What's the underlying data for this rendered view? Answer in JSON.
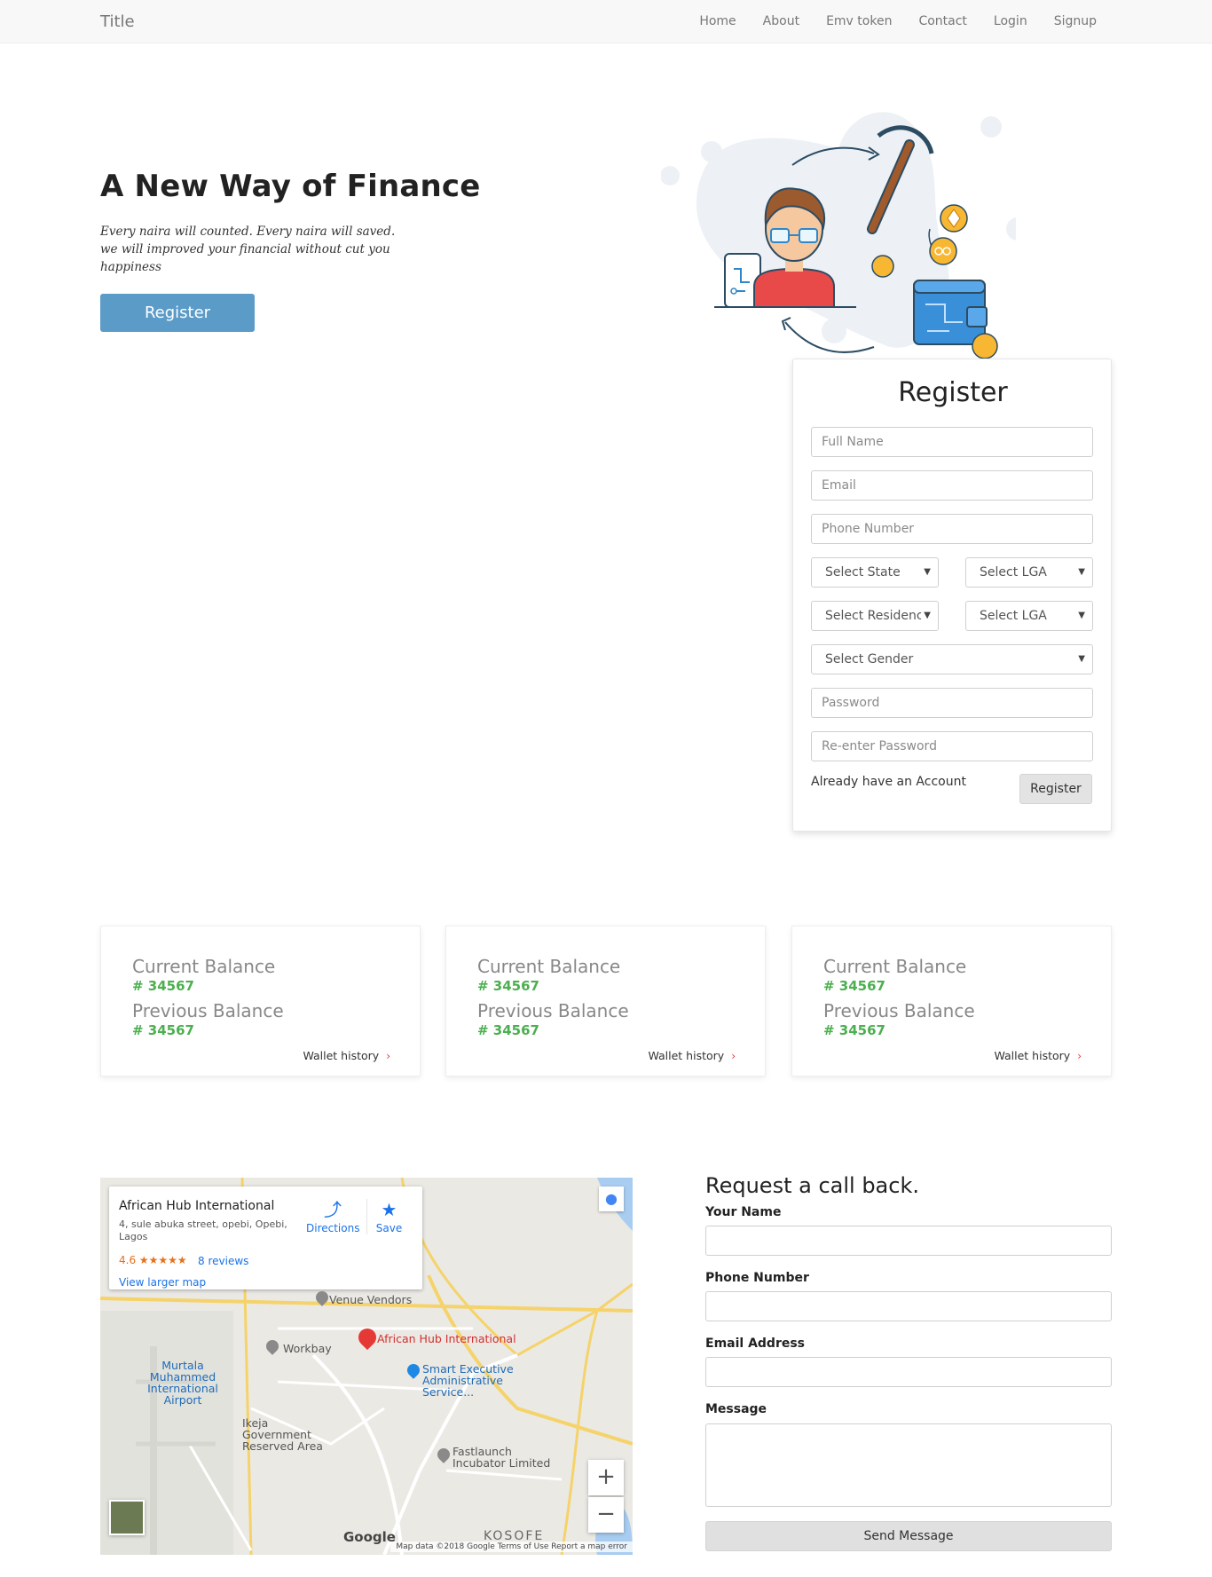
{
  "navbar": {
    "brand": "Title",
    "links": [
      "Home",
      "About",
      "Emv token",
      "Contact",
      "Login",
      "Signup"
    ]
  },
  "hero": {
    "title": "A New Way of Finance",
    "subtitle_line1": "Every naira will counted. Every naira will saved.",
    "subtitle_line2": "we will improved your financial without cut you happiness",
    "button": "Register"
  },
  "register_form": {
    "title": "Register",
    "full_name_placeholder": "Full Name",
    "email_placeholder": "Email",
    "phone_placeholder": "Phone Number",
    "select_state": "Select State",
    "select_lga": "Select LGA",
    "select_residence": "Select Residence",
    "select_lga_2": "Select LGA",
    "select_gender": "Select Gender",
    "password_placeholder": "Password",
    "reenter_password_placeholder": "Re-enter Password",
    "already_account": "Already have an Account",
    "submit": "Register"
  },
  "balances": [
    {
      "current_label": "Current Balance",
      "current_value": "# 34567",
      "previous_label": "Previous Balance",
      "previous_value": "# 34567",
      "link": "Wallet history"
    },
    {
      "current_label": "Current Balance",
      "current_value": "# 34567",
      "previous_label": "Previous Balance",
      "previous_value": "# 34567",
      "link": "Wallet history"
    },
    {
      "current_label": "Current Balance",
      "current_value": "# 34567",
      "previous_label": "Previous Balance",
      "previous_value": "# 34567",
      "link": "Wallet history"
    }
  ],
  "map": {
    "place_name": "African Hub International",
    "address": "4, sule abuka street, opebi, Opebi, Lagos",
    "rating": "4.6 ★★★★★",
    "reviews": "8 reviews",
    "view_larger": "View larger map",
    "directions": "Directions",
    "save": "Save",
    "labels": {
      "venue_vendors": "Venue Vendors",
      "workbay": "Workbay",
      "african_hub": "African Hub International",
      "smart_exec": "Smart Executive Administrative Service...",
      "murtala": "Murtala Muhammed International Airport",
      "ikeja_gov": "Ikeja Government Reserved Area",
      "fastlaunch": "Fastlaunch Incubator Limited",
      "kosofe": "KOSOFE",
      "google": "Google",
      "footer": "Map data ©2018 Google   Terms of Use   Report a map error"
    }
  },
  "callback": {
    "title": "Request a call back.",
    "name_label": "Your Name",
    "phone_label": "Phone Number",
    "email_label": "Email Address",
    "message_label": "Message",
    "send": "Send Message"
  },
  "colors": {
    "primary_button": "#5b9bc8",
    "balance_value": "#4caf50",
    "wallet_chevron": "#e53935"
  }
}
